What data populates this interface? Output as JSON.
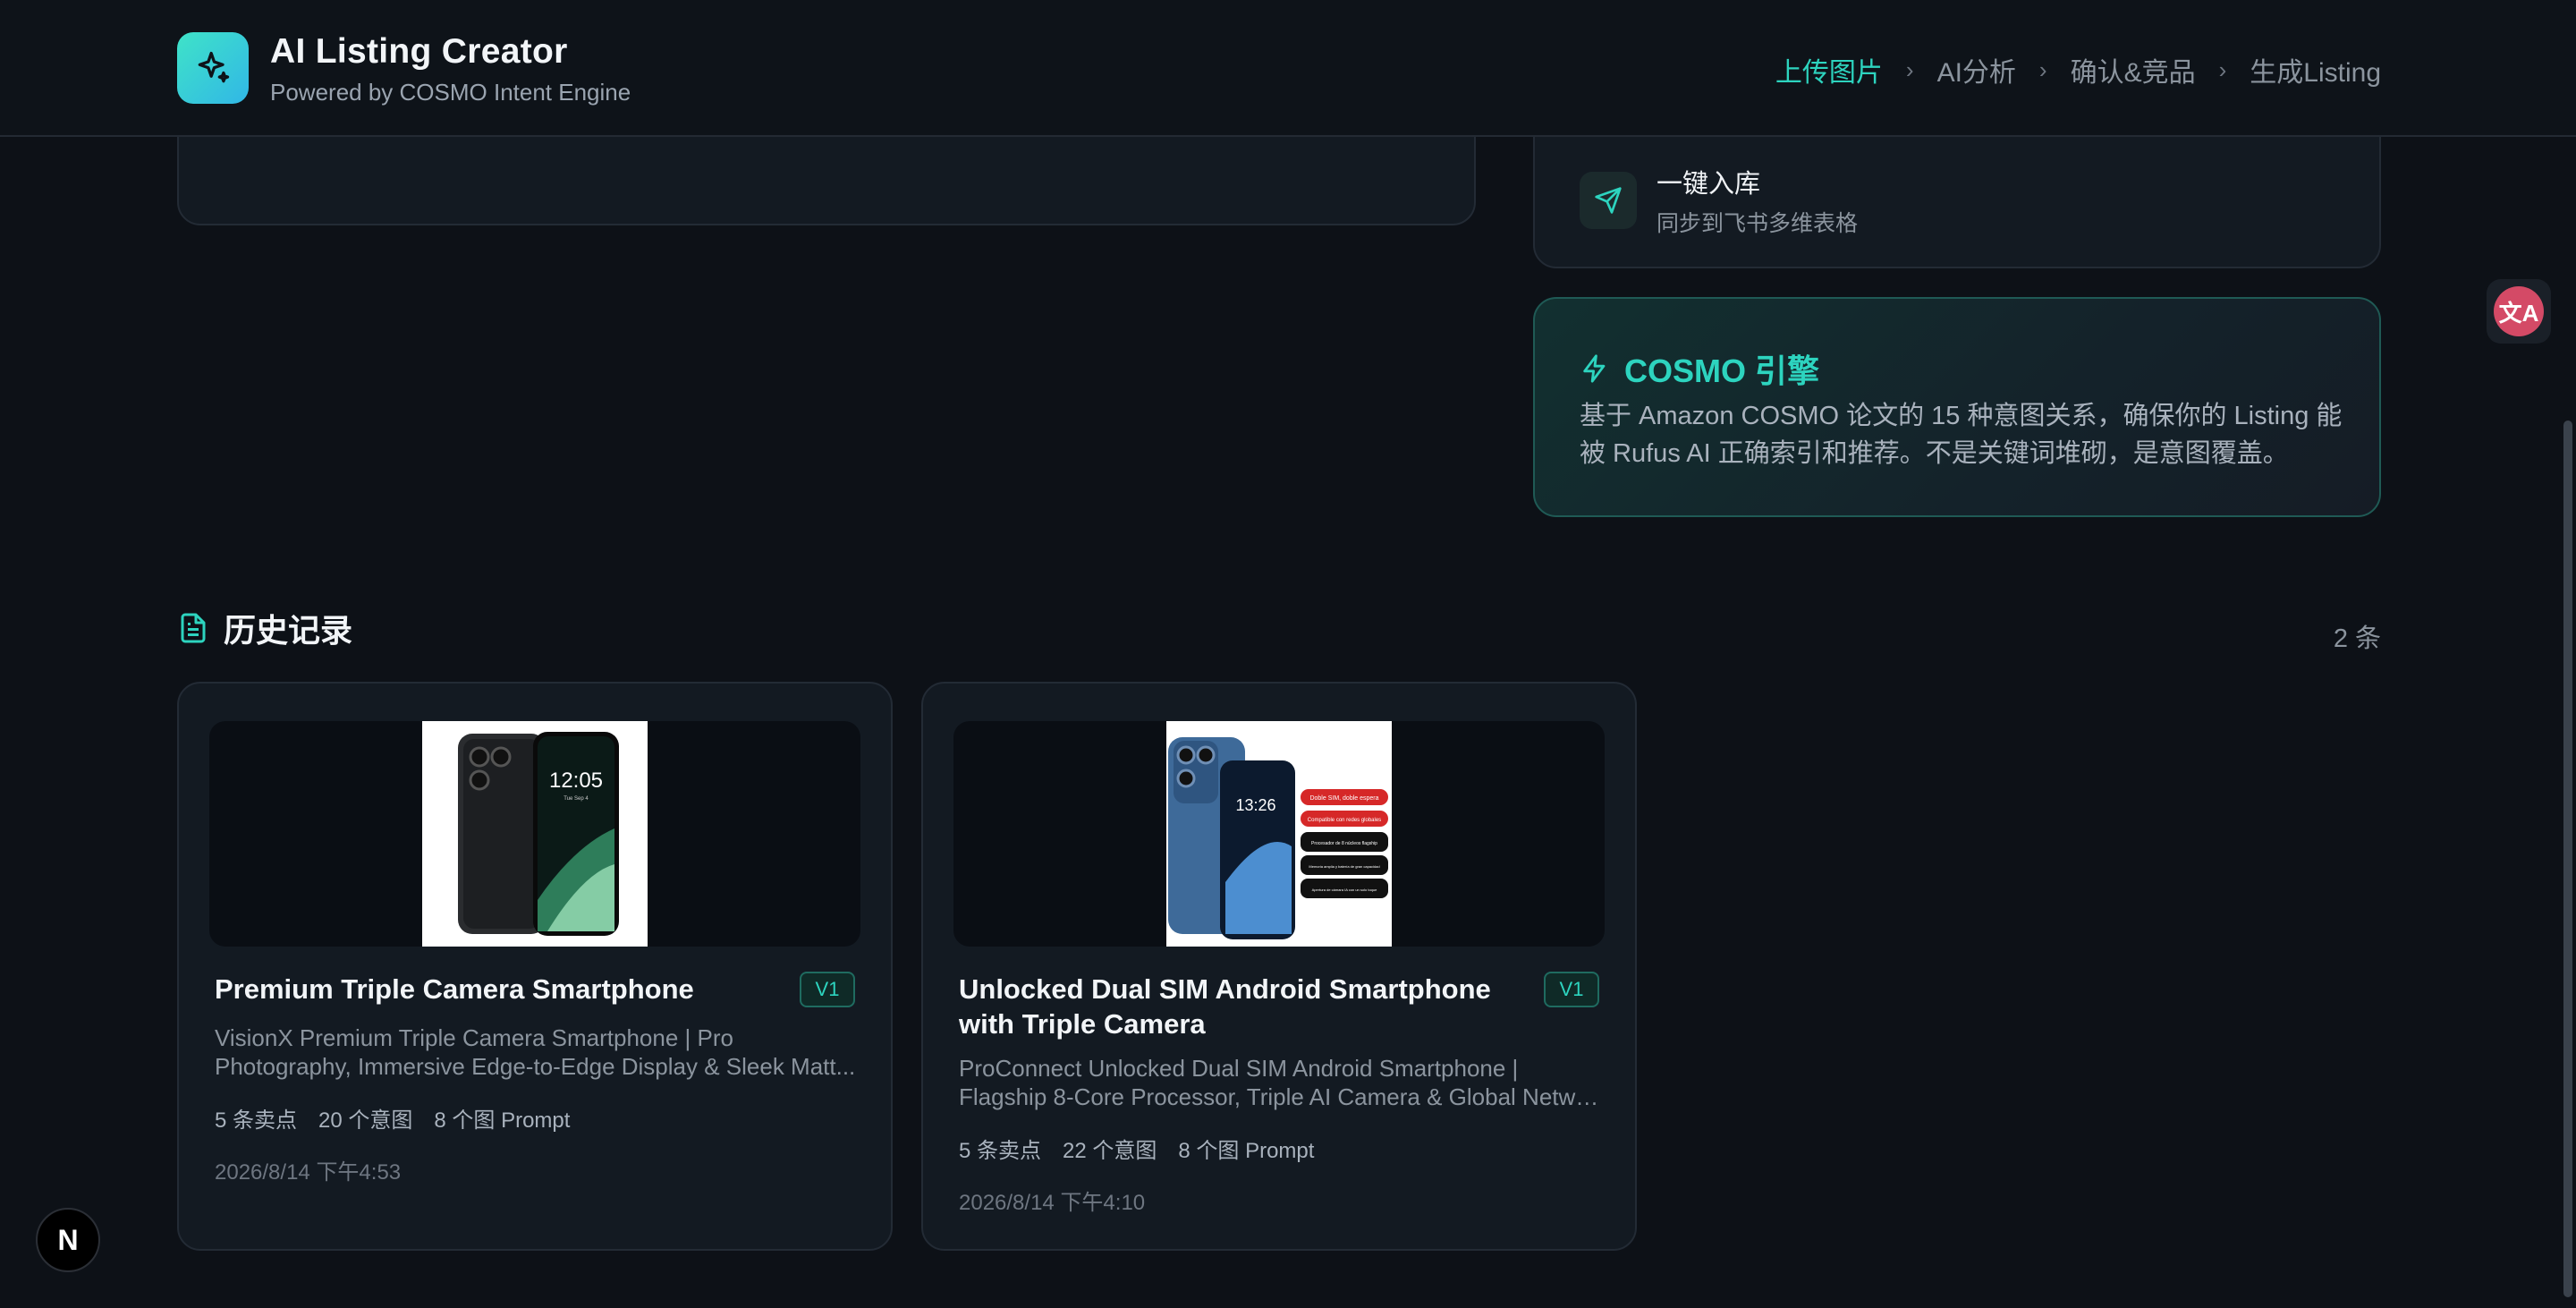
{
  "header": {
    "title": "AI Listing Creator",
    "subtitle": "Powered by COSMO Intent Engine",
    "steps": [
      {
        "label": "上传图片",
        "active": true
      },
      {
        "label": "AI分析",
        "active": false
      },
      {
        "label": "确认&竞品",
        "active": false
      },
      {
        "label": "生成Listing",
        "active": false
      }
    ]
  },
  "features": {
    "publish": {
      "title": "一键入库",
      "desc": "同步到飞书多维表格",
      "icon": "send-icon"
    }
  },
  "cosmo": {
    "title": "COSMO 引擎",
    "desc": "基于 Amazon COSMO 论文的 15 种意图关系，确保你的 Listing 能被 Rufus AI 正确索引和推荐。不是关键词堆砌，是意图覆盖。",
    "icon": "lightning-icon"
  },
  "history": {
    "title": "历史记录",
    "count": "2 条",
    "items": [
      {
        "title": "Premium Triple Camera Smartphone",
        "badge": "V1",
        "desc_line1": "VisionX Premium Triple Camera Smartphone | Pro",
        "desc_line2": "Photography, Immersive Edge-to-Edge Display & Sleek Matt...",
        "stats": [
          "5 条卖点",
          "20 个意图",
          "8 个图 Prompt"
        ],
        "date": "2026/8/14 下午4:53",
        "image_text": {
          "time": "12:05",
          "date": "Tue Sep 4"
        }
      },
      {
        "title_line1": "Unlocked Dual SIM Android Smartphone",
        "title_line2": "with Triple Camera",
        "badge": "V1",
        "desc_line1": "ProConnect Unlocked Dual SIM Android Smartphone |",
        "desc_line2": "Flagship 8-Core Processor, Triple AI Camera & Global Netwo...",
        "stats": [
          "5 条卖点",
          "22 个意图",
          "8 个图 Prompt"
        ],
        "date": "2026/8/14 下午4:10",
        "image_text": {
          "time": "13:26",
          "tags": [
            "Doble SIM, doble espera",
            "Compatible con redes globales",
            "Procesador de 8 núcleos flagship",
            "Memoria amplia y batería de gran capacidad",
            "Apertura de cámara IA con un solo toque"
          ]
        }
      }
    ]
  },
  "colors": {
    "accent": "#2dd4bf",
    "background": "#0d1117",
    "card": "#131a22"
  },
  "overlay": {
    "translate_label": "文A",
    "next_label": "N"
  }
}
